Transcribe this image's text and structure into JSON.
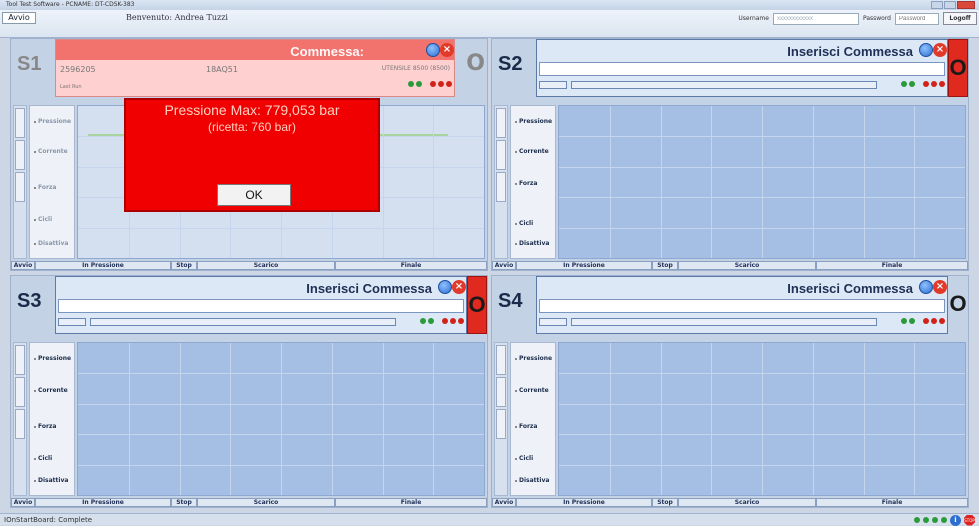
{
  "window": {
    "title": "Tool Test Software - PCNAME: DT-CDSK-383"
  },
  "topbar": {
    "avvio": "Avvio",
    "welcome": "Benvenuto: Andrea Tuzzi",
    "username_label": "Username",
    "username_value": "xxxxxxxxxxxx",
    "password_label": "Password",
    "password_placeholder": "Password",
    "logoff": "Logoff"
  },
  "stations": [
    {
      "id": "S1",
      "commessa_label": "Commessa:",
      "commessa_value": "",
      "code1": "2596205",
      "code2": "18AQ51",
      "utensile": "UTENSILE 8500 (8500)",
      "status": "Last Run",
      "o_letter": "O"
    },
    {
      "id": "S2",
      "title": "Inserisci Commessa",
      "o_letter": "O"
    },
    {
      "id": "S3",
      "title": "Inserisci Commessa",
      "o_letter": "O"
    },
    {
      "id": "S4",
      "title": "Inserisci Commessa",
      "o_letter": "O"
    }
  ],
  "legend": [
    "Pressione",
    "Corrente",
    "Forza",
    "Cicli",
    "Disattiva"
  ],
  "footer": [
    "Avvio",
    "In Pressione",
    "Stop",
    "Scarico",
    "Finale"
  ],
  "modal": {
    "line1": "Pressione Max: 779,053 bar",
    "line2": "(ricetta: 760 bar)",
    "ok": "OK"
  },
  "statusbar": {
    "text": "IOnStartBoard: Complete",
    "stop_icon_text": "STOP"
  },
  "colors": {
    "alarm_red": "#f00000",
    "led_green": "#2a9a3a",
    "led_red": "#d2231a",
    "panel_blue": "#a5bee3"
  }
}
